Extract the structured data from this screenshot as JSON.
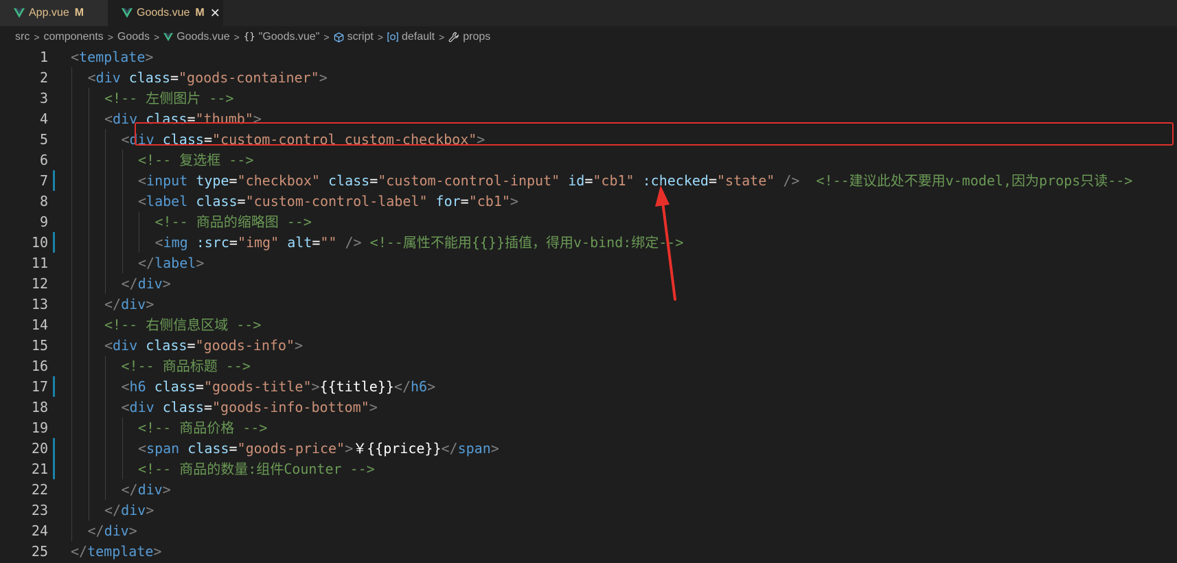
{
  "tabs": [
    {
      "label": "App.vue",
      "badge": "M",
      "active": false
    },
    {
      "label": "Goods.vue",
      "badge": "M",
      "active": true,
      "close": "✕"
    }
  ],
  "breadcrumb": {
    "items": [
      "src",
      "components",
      "Goods",
      "Goods.vue",
      "\"Goods.vue\"",
      "script",
      "default",
      "props"
    ]
  },
  "editor": {
    "line_numbers": [
      "1",
      "2",
      "3",
      "4",
      "5",
      "6",
      "7",
      "8",
      "9",
      "10",
      "11",
      "12",
      "13",
      "14",
      "15",
      "16",
      "17",
      "18",
      "19",
      "20",
      "21",
      "22",
      "23",
      "24",
      "25"
    ],
    "lines": [
      [
        [
          "tb",
          "<"
        ],
        [
          "tg",
          "template"
        ],
        [
          "tb",
          ">"
        ]
      ],
      [
        [
          "tb",
          "<"
        ],
        [
          "tg",
          "div"
        ],
        [
          "tx",
          " "
        ],
        [
          "at",
          "class"
        ],
        [
          "tx",
          "="
        ],
        [
          "st",
          "\"goods-container\""
        ],
        [
          "tb",
          ">"
        ]
      ],
      [
        [
          "cm",
          "<!-- 左侧图片 -->"
        ]
      ],
      [
        [
          "tb",
          "<"
        ],
        [
          "tg",
          "div"
        ],
        [
          "tx",
          " "
        ],
        [
          "at",
          "class"
        ],
        [
          "tx",
          "="
        ],
        [
          "st",
          "\"thumb\""
        ],
        [
          "tb",
          ">"
        ]
      ],
      [
        [
          "tb",
          "<"
        ],
        [
          "tg",
          "div"
        ],
        [
          "tx",
          " "
        ],
        [
          "at",
          "class"
        ],
        [
          "tx",
          "="
        ],
        [
          "st",
          "\"custom-control custom-checkbox\""
        ],
        [
          "tb",
          ">"
        ]
      ],
      [
        [
          "cm",
          "<!-- 复选框 -->"
        ]
      ],
      [
        [
          "tb",
          "<"
        ],
        [
          "tg",
          "input"
        ],
        [
          "tx",
          " "
        ],
        [
          "at",
          "type"
        ],
        [
          "tx",
          "="
        ],
        [
          "st",
          "\"checkbox\""
        ],
        [
          "tx",
          " "
        ],
        [
          "at",
          "class"
        ],
        [
          "tx",
          "="
        ],
        [
          "st",
          "\"custom-control-input\""
        ],
        [
          "tx",
          " "
        ],
        [
          "at",
          "id"
        ],
        [
          "tx",
          "="
        ],
        [
          "st",
          "\"cb1\""
        ],
        [
          "tx",
          " "
        ],
        [
          "at",
          ":checked"
        ],
        [
          "tx",
          "="
        ],
        [
          "st",
          "\"state\""
        ],
        [
          "tx",
          " "
        ],
        [
          "tb",
          "/>"
        ],
        [
          "tx",
          "  "
        ],
        [
          "cm",
          "<!--建议此处不要用v-model,因为props只读-->"
        ]
      ],
      [
        [
          "tb",
          "<"
        ],
        [
          "tg",
          "label"
        ],
        [
          "tx",
          " "
        ],
        [
          "at",
          "class"
        ],
        [
          "tx",
          "="
        ],
        [
          "st",
          "\"custom-control-label\""
        ],
        [
          "tx",
          " "
        ],
        [
          "at",
          "for"
        ],
        [
          "tx",
          "="
        ],
        [
          "st",
          "\"cb1\""
        ],
        [
          "tb",
          ">"
        ]
      ],
      [
        [
          "cm",
          "<!-- 商品的缩略图 -->"
        ]
      ],
      [
        [
          "tb",
          "<"
        ],
        [
          "tg",
          "img"
        ],
        [
          "tx",
          " "
        ],
        [
          "at",
          ":src"
        ],
        [
          "tx",
          "="
        ],
        [
          "st",
          "\"img\""
        ],
        [
          "tx",
          " "
        ],
        [
          "at",
          "alt"
        ],
        [
          "tx",
          "="
        ],
        [
          "st",
          "\"\""
        ],
        [
          "tx",
          " "
        ],
        [
          "tb",
          "/>"
        ],
        [
          "tx",
          " "
        ],
        [
          "cm",
          "<!--属性不能用{{}}插值，得用v-bind:绑定-->"
        ]
      ],
      [
        [
          "tb",
          "</"
        ],
        [
          "tg",
          "label"
        ],
        [
          "tb",
          ">"
        ]
      ],
      [
        [
          "tb",
          "</"
        ],
        [
          "tg",
          "div"
        ],
        [
          "tb",
          ">"
        ]
      ],
      [
        [
          "tb",
          "</"
        ],
        [
          "tg",
          "div"
        ],
        [
          "tb",
          ">"
        ]
      ],
      [
        [
          "cm",
          "<!-- 右侧信息区域 -->"
        ]
      ],
      [
        [
          "tb",
          "<"
        ],
        [
          "tg",
          "div"
        ],
        [
          "tx",
          " "
        ],
        [
          "at",
          "class"
        ],
        [
          "tx",
          "="
        ],
        [
          "st",
          "\"goods-info\""
        ],
        [
          "tb",
          ">"
        ]
      ],
      [
        [
          "cm",
          "<!-- 商品标题 -->"
        ]
      ],
      [
        [
          "tb",
          "<"
        ],
        [
          "tg",
          "h6"
        ],
        [
          "tx",
          " "
        ],
        [
          "at",
          "class"
        ],
        [
          "tx",
          "="
        ],
        [
          "st",
          "\"goods-title\""
        ],
        [
          "tb",
          ">"
        ],
        [
          "tx",
          "{{title}}"
        ],
        [
          "tb",
          "</"
        ],
        [
          "tg",
          "h6"
        ],
        [
          "tb",
          ">"
        ]
      ],
      [
        [
          "tb",
          "<"
        ],
        [
          "tg",
          "div"
        ],
        [
          "tx",
          " "
        ],
        [
          "at",
          "class"
        ],
        [
          "tx",
          "="
        ],
        [
          "st",
          "\"goods-info-bottom\""
        ],
        [
          "tb",
          ">"
        ]
      ],
      [
        [
          "cm",
          "<!-- 商品价格 -->"
        ]
      ],
      [
        [
          "tb",
          "<"
        ],
        [
          "tg",
          "span"
        ],
        [
          "tx",
          " "
        ],
        [
          "at",
          "class"
        ],
        [
          "tx",
          "="
        ],
        [
          "st",
          "\"goods-price\""
        ],
        [
          "tb",
          ">"
        ],
        [
          "tx",
          "￥{{price}}"
        ],
        [
          "tb",
          "</"
        ],
        [
          "tg",
          "span"
        ],
        [
          "tb",
          ">"
        ]
      ],
      [
        [
          "cm",
          "<!-- 商品的数量:组件Counter -->"
        ]
      ],
      [
        [
          "tb",
          "</"
        ],
        [
          "tg",
          "div"
        ],
        [
          "tb",
          ">"
        ]
      ],
      [
        [
          "tb",
          "</"
        ],
        [
          "tg",
          "div"
        ],
        [
          "tb",
          ">"
        ]
      ],
      [
        [
          "tb",
          "</"
        ],
        [
          "tg",
          "div"
        ],
        [
          "tb",
          ">"
        ]
      ],
      [
        [
          "tb",
          "</"
        ],
        [
          "tg",
          "template"
        ],
        [
          "tb",
          ">"
        ]
      ]
    ],
    "modified_lines": [
      7,
      10,
      17,
      20,
      21
    ],
    "highlighted_line": 7
  },
  "colors": {
    "tag": "#569cd6",
    "attribute": "#9cdcfe",
    "string": "#ce9178",
    "comment": "#6a9955",
    "highlight": "#e0312b",
    "modified_badge": "#e2c08d"
  }
}
